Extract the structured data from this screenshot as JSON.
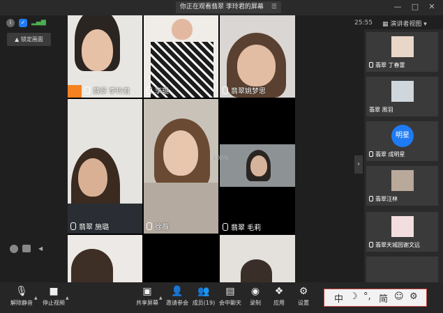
{
  "banner": {
    "text": "你正在观看翡翠 李玲君的屏幕"
  },
  "window": {
    "minimize": "—",
    "maximize": "□",
    "close": "✕"
  },
  "status": {
    "time": "25:55",
    "view_mode": "演讲者视图 ▾"
  },
  "lock_button": {
    "label": "锁定画面"
  },
  "grid_tiles": [
    {
      "name": "翡翠 李玲君",
      "speaking": true
    },
    {
      "name": "李琨"
    },
    {
      "name": "翡翠姚梦思"
    },
    {
      "name": "翡翠 施璐"
    },
    {
      "name": "徐薇"
    },
    {
      "name": "翡翠 毛莉"
    }
  ],
  "zoom_overlay": "100%",
  "right_panel": [
    {
      "name": "翡翠 丁春雷"
    },
    {
      "name": "翡翠 周羽"
    },
    {
      "name": "翡翠 成明星",
      "avatar_text": "明星"
    },
    {
      "name": "翡翠汪林"
    },
    {
      "name": "翡翠天城园谢文远"
    }
  ],
  "toolbar": {
    "unmute": "解除静音",
    "stop_video": "停止视频",
    "share_screen": "共享屏幕",
    "invite": "邀请参会",
    "members": "成员(19)",
    "chat": "会中聊天",
    "record": "录制",
    "apps": "应用",
    "settings": "设置"
  },
  "ime": {
    "lang": "中",
    "moon": "☽",
    "punct": "°,",
    "simp": "简",
    "emoji": "☺",
    "gear": "⚙"
  },
  "colors": {
    "accent": "#1f7bf3",
    "speaker_badge": "#f58220",
    "background": "#1f1f1f"
  }
}
